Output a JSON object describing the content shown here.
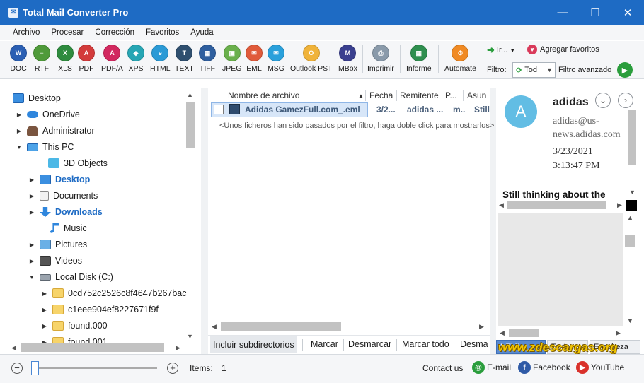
{
  "window": {
    "title": "Total Mail Converter Pro",
    "controls": [
      "minimize",
      "maximize",
      "close"
    ]
  },
  "menu": [
    "Archivo",
    "Procesar",
    "Corrección",
    "Favoritos",
    "Ayuda"
  ],
  "toolbar": {
    "buttons": [
      {
        "label": "DOC",
        "icon": "doc-icon",
        "color": "#2b5fb3"
      },
      {
        "label": "RTF",
        "icon": "rtf-icon",
        "color": "#4f9a3a"
      },
      {
        "label": "XLS",
        "icon": "xls-icon",
        "color": "#2e8b3e"
      },
      {
        "label": "PDF",
        "icon": "pdf-icon",
        "color": "#d33b3b"
      },
      {
        "label": "PDF/A",
        "icon": "pdfa-icon",
        "color": "#d2285f"
      },
      {
        "label": "XPS",
        "icon": "xps-icon",
        "color": "#27a6b4"
      },
      {
        "label": "HTML",
        "icon": "html-icon",
        "color": "#2a9ad6"
      },
      {
        "label": "TEXT",
        "icon": "text-icon",
        "color": "#2f4f6f"
      },
      {
        "label": "TIFF",
        "icon": "tiff-icon",
        "color": "#2f5f9f"
      },
      {
        "label": "JPEG",
        "icon": "jpeg-icon",
        "color": "#6ab04c"
      },
      {
        "label": "EML",
        "icon": "eml-icon",
        "color": "#e05a3a"
      },
      {
        "label": "MSG",
        "icon": "msg-icon",
        "color": "#2aa0db"
      },
      {
        "label": "Outlook PST",
        "icon": "outlook-pst-icon",
        "color": "#f0b33a"
      },
      {
        "label": "MBox",
        "icon": "mbox-icon",
        "color": "#3a3f8f"
      },
      {
        "label": "Imprimir",
        "icon": "printer-icon",
        "color": "#8a9aaa"
      },
      {
        "label": "Informe",
        "icon": "report-icon",
        "color": "#2f8f4f"
      },
      {
        "label": "Automate",
        "icon": "automate-icon",
        "color": "#f08a24"
      }
    ],
    "goto_label": "Ir...",
    "favorites_label": "Agregar favoritos",
    "filter_label": "Filtro:",
    "filter_value": "Tod",
    "advanced_filter_label": "Filtro avanzado"
  },
  "tree": {
    "items": [
      {
        "label": "Desktop",
        "icon": "desktop-icon",
        "arrow": "",
        "blue": false
      },
      {
        "label": "OneDrive",
        "icon": "onedrive-icon",
        "arrow": "▶",
        "blue": false
      },
      {
        "label": "Administrator",
        "icon": "user-icon",
        "arrow": "▶",
        "blue": false
      },
      {
        "label": "This PC",
        "icon": "pc-icon",
        "arrow": "▼",
        "blue": false
      },
      {
        "label": "3D Objects",
        "icon": "3d-objects-icon",
        "arrow": "",
        "blue": false
      },
      {
        "label": "Desktop",
        "icon": "desktop-icon",
        "arrow": "▶",
        "blue": true
      },
      {
        "label": "Documents",
        "icon": "documents-icon",
        "arrow": "▶",
        "blue": false
      },
      {
        "label": "Downloads",
        "icon": "downloads-icon",
        "arrow": "▶",
        "blue": true
      },
      {
        "label": "Music",
        "icon": "music-icon",
        "arrow": "",
        "blue": false
      },
      {
        "label": "Pictures",
        "icon": "pictures-icon",
        "arrow": "▶",
        "blue": false
      },
      {
        "label": "Videos",
        "icon": "videos-icon",
        "arrow": "▶",
        "blue": false
      },
      {
        "label": "Local Disk (C:)",
        "icon": "disk-icon",
        "arrow": "▼",
        "blue": false
      },
      {
        "label": "0cd752c2526c8f4647b267bac",
        "icon": "folder-icon",
        "arrow": "▶",
        "blue": false
      },
      {
        "label": "c1eee904ef8227671f9f",
        "icon": "folder-icon",
        "arrow": "▶",
        "blue": false
      },
      {
        "label": "found.000",
        "icon": "folder-icon",
        "arrow": "▶",
        "blue": false
      },
      {
        "label": "found.001",
        "icon": "folder-icon",
        "arrow": "▶",
        "blue": false
      }
    ]
  },
  "filelist": {
    "columns": [
      "Nombre de archivo",
      "Fecha",
      "Remitente",
      "P...",
      "Asunto"
    ],
    "columns_visible": [
      "Nombre de archivo",
      "Fecha",
      "Remitente",
      "P...",
      "Asun"
    ],
    "rows": [
      {
        "name": "Adidas GamezFull.com_.eml",
        "date": "3/2...",
        "sender": "adidas ...",
        "p": "m..",
        "subject": "Still"
      }
    ],
    "filter_note": "<Unos ficheros han sido pasados por el filtro, haga doble click para mostrarlos>",
    "actions": [
      "Incluir subdirectorios",
      "Marcar",
      "Desmarcar",
      "Marcar todo",
      "Desma"
    ]
  },
  "preview": {
    "avatar_letter": "A",
    "sender_name": "adidas",
    "sender_email": "adidas@us-news.adidas.com",
    "date": "3/23/2021",
    "time": "3:13:47 PM",
    "subject": "Still thinking about the",
    "tabs": [
      "HTML",
      "Texto",
      "Encabeza"
    ]
  },
  "watermark": "www.zdescargas.org",
  "status": {
    "items_label": "Items:",
    "items_count": "1",
    "contact_label": "Contact us",
    "email_label": "E-mail",
    "facebook_label": "Facebook",
    "youtube_label": "YouTube"
  }
}
